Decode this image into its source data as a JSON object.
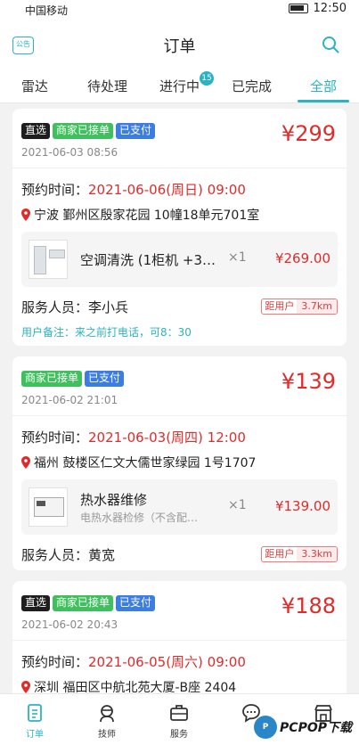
{
  "status_bar": {
    "carrier": "中国移动",
    "time": "12:50"
  },
  "header": {
    "title": "订单",
    "notice_label": "公告"
  },
  "tabs": [
    {
      "label": "雷达"
    },
    {
      "label": "待处理"
    },
    {
      "label": "进行中",
      "badge": "15"
    },
    {
      "label": "已完成"
    },
    {
      "label": "全部",
      "active": true
    }
  ],
  "common": {
    "appt_prefix": "预约时间：",
    "staff_prefix": "服务人员：",
    "distance_label": "距用户"
  },
  "orders": [
    {
      "tags": [
        "直选",
        "商家已接单",
        "已支付"
      ],
      "price": "¥299",
      "date": "2021-06-03 08:56",
      "appointment_time": "2021-06-06(周日) 09:00",
      "address": "宁波 鄞州区殷家花园 10幢18单元701室",
      "item": {
        "name": "空调清洗 (1柜机 +3…",
        "desc": "",
        "qty": "×1",
        "price": "¥269.00"
      },
      "staff": "李小兵",
      "distance": "3.7km",
      "remark": "用户备注：来之前打电话，可8：30"
    },
    {
      "tags": [
        "商家已接单",
        "已支付"
      ],
      "price": "¥139",
      "date": "2021-06-02 21:01",
      "appointment_time": "2021-06-03(周四) 12:00",
      "address": "福州 鼓楼区仁文大儒世家绿园 1号1707",
      "item": {
        "name": "热水器维修",
        "desc": "电热水器检修（不含配…",
        "qty": "×1",
        "price": "¥139.00"
      },
      "staff": "黄宽",
      "distance": "3.3km"
    },
    {
      "tags": [
        "直选",
        "商家已接单",
        "已支付"
      ],
      "price": "¥188",
      "date": "2021-06-02 20:43",
      "appointment_time": "2021-06-05(周六) 09:00",
      "address": "深圳 福田区中航北苑大厦-B座 2404"
    }
  ],
  "tabbar": [
    {
      "label": "订单",
      "icon": "order-icon",
      "active": true
    },
    {
      "label": "技师",
      "icon": "technician-icon"
    },
    {
      "label": "服务",
      "icon": "service-icon"
    },
    {
      "label": "",
      "icon": "message-icon"
    },
    {
      "label": "",
      "icon": "store-icon"
    }
  ],
  "watermark": {
    "logo": "P",
    "text": "PCPOP下载"
  },
  "colors": {
    "accent": "#2bb3c0",
    "price_red": "#e02b2b",
    "tag_green": "#3ec05d",
    "tag_blue": "#3b7de0",
    "tag_black": "#1e1e1e"
  }
}
